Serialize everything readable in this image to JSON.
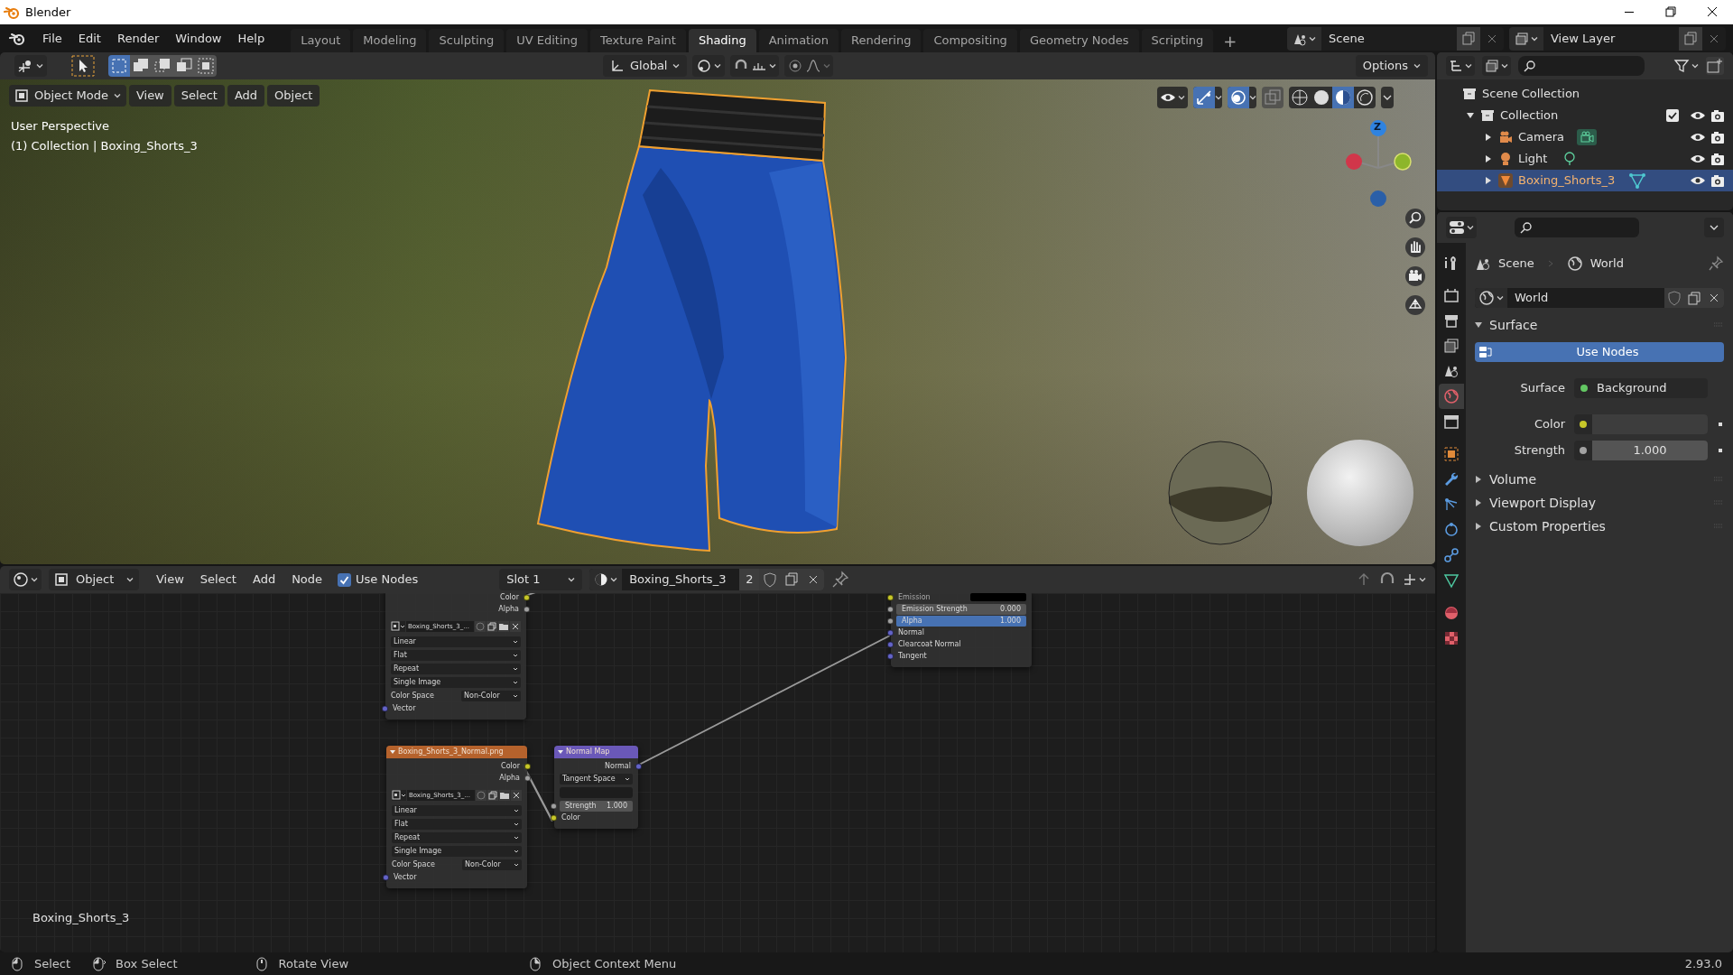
{
  "window": {
    "title": "Blender"
  },
  "menu": [
    "File",
    "Edit",
    "Render",
    "Window",
    "Help"
  ],
  "workspaces": [
    {
      "label": "Layout",
      "selected": false
    },
    {
      "label": "Modeling",
      "selected": false
    },
    {
      "label": "Sculpting",
      "selected": false
    },
    {
      "label": "UV Editing",
      "selected": false
    },
    {
      "label": "Texture Paint",
      "selected": false
    },
    {
      "label": "Shading",
      "selected": true
    },
    {
      "label": "Animation",
      "selected": false
    },
    {
      "label": "Rendering",
      "selected": false
    },
    {
      "label": "Compositing",
      "selected": false
    },
    {
      "label": "Geometry Nodes",
      "selected": false
    },
    {
      "label": "Scripting",
      "selected": false
    }
  ],
  "add_workspace": "+",
  "scene": "Scene",
  "view_layer": "View Layer",
  "viewport": {
    "transform_orientation": "Global",
    "options": "Options",
    "mode": "Object Mode",
    "menus": [
      "View",
      "Select",
      "Add",
      "Object"
    ],
    "info": [
      "User Perspective",
      "(1) Collection | Boxing_Shorts_3"
    ],
    "gizmo_axis": "Z"
  },
  "node_editor": {
    "object_type": "Object",
    "menus": [
      "View",
      "Select",
      "Add",
      "Node"
    ],
    "use_nodes": {
      "label": "Use Nodes",
      "checked": true
    },
    "slot": "Slot 1",
    "material": "Boxing_Shorts_3",
    "users": "2",
    "nodes": [
      {
        "kind": "image_texture",
        "rows": [
          {
            "kind": "output",
            "label": "Color",
            "color": "#c7c729"
          },
          {
            "kind": "output",
            "label": "Alpha",
            "color": "#a1a1a1"
          },
          {
            "kind": "image",
            "value": "Boxing_Shorts_3_..."
          },
          {
            "kind": "dropdown",
            "value": "Linear"
          },
          {
            "kind": "dropdown",
            "value": "Flat"
          },
          {
            "kind": "dropdown",
            "value": "Repeat"
          },
          {
            "kind": "dropdown",
            "value": "Single Image"
          },
          {
            "kind": "labeled_dropdown",
            "label": "Color Space",
            "value": "Non-Color"
          },
          {
            "kind": "input",
            "label": "Vector",
            "color": "#6363c7"
          }
        ]
      },
      {
        "kind": "image_texture",
        "title": "Boxing_Shorts_3_Normal.png",
        "rows": [
          {
            "kind": "output",
            "label": "Color",
            "color": "#c7c729"
          },
          {
            "kind": "output",
            "label": "Alpha",
            "color": "#a1a1a1"
          },
          {
            "kind": "image",
            "value": "Boxing_Shorts_3_..."
          },
          {
            "kind": "dropdown",
            "value": "Linear"
          },
          {
            "kind": "dropdown",
            "value": "Flat"
          },
          {
            "kind": "dropdown",
            "value": "Repeat"
          },
          {
            "kind": "dropdown",
            "value": "Single Image"
          },
          {
            "kind": "labeled_dropdown",
            "label": "Color Space",
            "value": "Non-Color"
          },
          {
            "kind": "input",
            "label": "Vector",
            "color": "#6363c7"
          }
        ]
      },
      {
        "kind": "normal_map",
        "title": "Normal Map",
        "rows": [
          {
            "kind": "output",
            "label": "Normal",
            "color": "#6363c7"
          },
          {
            "kind": "dropdown",
            "value": "Tangent Space"
          },
          {
            "kind": "uv_field"
          },
          {
            "kind": "number",
            "label": "Strength",
            "value": "1.000",
            "color": "#a1a1a1"
          },
          {
            "kind": "input",
            "label": "Color",
            "color": "#c7c729"
          }
        ]
      },
      {
        "kind": "principled",
        "rows": [
          {
            "kind": "swatch_input",
            "label": "Emission",
            "color": "#c7c729"
          },
          {
            "kind": "number",
            "label": "Emission Strength",
            "value": "0.000",
            "color": "#a1a1a1"
          },
          {
            "kind": "slider",
            "label": "Alpha",
            "value": "1.000",
            "level": 1,
            "color": "#a1a1a1"
          },
          {
            "kind": "input",
            "label": "Normal",
            "color": "#6363c7"
          },
          {
            "kind": "input",
            "label": "Clearcoat Normal",
            "color": "#6363c7"
          },
          {
            "kind": "input",
            "label": "Tangent",
            "color": "#6363c7"
          }
        ]
      }
    ],
    "label": "Boxing_Shorts_3"
  },
  "outliner": {
    "items": [
      {
        "kind": "scene_collection",
        "label": "Scene Collection",
        "selected": false,
        "children": [
          {
            "kind": "collection",
            "label": "Collection",
            "expanded": true,
            "checked": true,
            "selected": false,
            "children": [
              {
                "kind": "camera",
                "label": "Camera",
                "expanded": false,
                "selected": false
              },
              {
                "kind": "light",
                "label": "Light",
                "expanded": false,
                "selected": false
              },
              {
                "kind": "mesh",
                "label": "Boxing_Shorts_3",
                "expanded": false,
                "selected": true
              }
            ]
          }
        ]
      }
    ]
  },
  "properties": {
    "tabs": [
      {
        "kind": "tool",
        "selected": false
      },
      {
        "kind": "render",
        "selected": false
      },
      {
        "kind": "output",
        "selected": false
      },
      {
        "kind": "view_layer",
        "selected": false
      },
      {
        "kind": "scene",
        "selected": false
      },
      {
        "kind": "world",
        "selected": true
      },
      {
        "kind": "collection",
        "selected": false
      },
      {
        "kind": "object",
        "selected": false
      },
      {
        "kind": "modifiers",
        "selected": false
      },
      {
        "kind": "particles",
        "selected": false
      },
      {
        "kind": "physics",
        "selected": false
      },
      {
        "kind": "constraints",
        "selected": false
      },
      {
        "kind": "data",
        "selected": false
      },
      {
        "kind": "material",
        "selected": false
      },
      {
        "kind": "texture",
        "selected": false
      }
    ],
    "breadcrumb": [
      "Scene",
      "World"
    ],
    "datablock": "World",
    "panels": [
      {
        "label": "Surface",
        "expanded": true,
        "button": "Use Nodes",
        "fields": [
          {
            "kind": "link",
            "label": "Surface",
            "value": "Background",
            "color": "#63c763"
          },
          {
            "kind": "color",
            "label": "Color",
            "color": "#c7c729"
          },
          {
            "kind": "number",
            "label": "Strength",
            "value": "1.000",
            "color": "#a1a1a1"
          }
        ]
      },
      {
        "label": "Volume",
        "expanded": false
      },
      {
        "label": "Viewport Display",
        "expanded": false
      },
      {
        "label": "Custom Properties",
        "expanded": false
      }
    ]
  },
  "status_bar": {
    "items": [
      {
        "kind": "left_click",
        "label": "Select"
      },
      {
        "kind": "drag",
        "label": "Box Select"
      },
      {
        "kind": "middle_click",
        "label": "Rotate View"
      },
      {
        "kind": "right_click",
        "label": "Object Context Menu"
      }
    ],
    "version": "2.93.0"
  }
}
